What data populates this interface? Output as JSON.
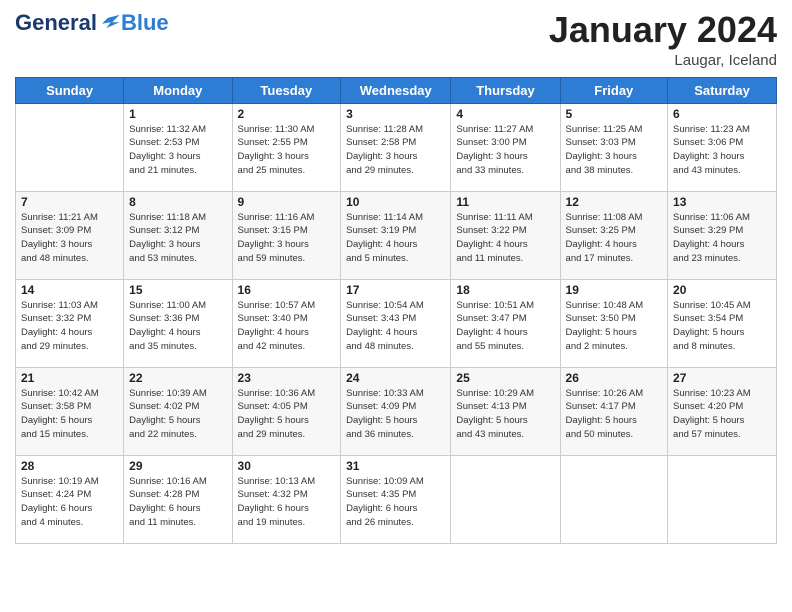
{
  "header": {
    "logo_general": "General",
    "logo_blue": "Blue",
    "month_title": "January 2024",
    "subtitle": "Laugar, Iceland"
  },
  "weekdays": [
    "Sunday",
    "Monday",
    "Tuesday",
    "Wednesday",
    "Thursday",
    "Friday",
    "Saturday"
  ],
  "weeks": [
    [
      {
        "num": "",
        "info": ""
      },
      {
        "num": "1",
        "info": "Sunrise: 11:32 AM\nSunset: 2:53 PM\nDaylight: 3 hours\nand 21 minutes."
      },
      {
        "num": "2",
        "info": "Sunrise: 11:30 AM\nSunset: 2:55 PM\nDaylight: 3 hours\nand 25 minutes."
      },
      {
        "num": "3",
        "info": "Sunrise: 11:28 AM\nSunset: 2:58 PM\nDaylight: 3 hours\nand 29 minutes."
      },
      {
        "num": "4",
        "info": "Sunrise: 11:27 AM\nSunset: 3:00 PM\nDaylight: 3 hours\nand 33 minutes."
      },
      {
        "num": "5",
        "info": "Sunrise: 11:25 AM\nSunset: 3:03 PM\nDaylight: 3 hours\nand 38 minutes."
      },
      {
        "num": "6",
        "info": "Sunrise: 11:23 AM\nSunset: 3:06 PM\nDaylight: 3 hours\nand 43 minutes."
      }
    ],
    [
      {
        "num": "7",
        "info": "Sunrise: 11:21 AM\nSunset: 3:09 PM\nDaylight: 3 hours\nand 48 minutes."
      },
      {
        "num": "8",
        "info": "Sunrise: 11:18 AM\nSunset: 3:12 PM\nDaylight: 3 hours\nand 53 minutes."
      },
      {
        "num": "9",
        "info": "Sunrise: 11:16 AM\nSunset: 3:15 PM\nDaylight: 3 hours\nand 59 minutes."
      },
      {
        "num": "10",
        "info": "Sunrise: 11:14 AM\nSunset: 3:19 PM\nDaylight: 4 hours\nand 5 minutes."
      },
      {
        "num": "11",
        "info": "Sunrise: 11:11 AM\nSunset: 3:22 PM\nDaylight: 4 hours\nand 11 minutes."
      },
      {
        "num": "12",
        "info": "Sunrise: 11:08 AM\nSunset: 3:25 PM\nDaylight: 4 hours\nand 17 minutes."
      },
      {
        "num": "13",
        "info": "Sunrise: 11:06 AM\nSunset: 3:29 PM\nDaylight: 4 hours\nand 23 minutes."
      }
    ],
    [
      {
        "num": "14",
        "info": "Sunrise: 11:03 AM\nSunset: 3:32 PM\nDaylight: 4 hours\nand 29 minutes."
      },
      {
        "num": "15",
        "info": "Sunrise: 11:00 AM\nSunset: 3:36 PM\nDaylight: 4 hours\nand 35 minutes."
      },
      {
        "num": "16",
        "info": "Sunrise: 10:57 AM\nSunset: 3:40 PM\nDaylight: 4 hours\nand 42 minutes."
      },
      {
        "num": "17",
        "info": "Sunrise: 10:54 AM\nSunset: 3:43 PM\nDaylight: 4 hours\nand 48 minutes."
      },
      {
        "num": "18",
        "info": "Sunrise: 10:51 AM\nSunset: 3:47 PM\nDaylight: 4 hours\nand 55 minutes."
      },
      {
        "num": "19",
        "info": "Sunrise: 10:48 AM\nSunset: 3:50 PM\nDaylight: 5 hours\nand 2 minutes."
      },
      {
        "num": "20",
        "info": "Sunrise: 10:45 AM\nSunset: 3:54 PM\nDaylight: 5 hours\nand 8 minutes."
      }
    ],
    [
      {
        "num": "21",
        "info": "Sunrise: 10:42 AM\nSunset: 3:58 PM\nDaylight: 5 hours\nand 15 minutes."
      },
      {
        "num": "22",
        "info": "Sunrise: 10:39 AM\nSunset: 4:02 PM\nDaylight: 5 hours\nand 22 minutes."
      },
      {
        "num": "23",
        "info": "Sunrise: 10:36 AM\nSunset: 4:05 PM\nDaylight: 5 hours\nand 29 minutes."
      },
      {
        "num": "24",
        "info": "Sunrise: 10:33 AM\nSunset: 4:09 PM\nDaylight: 5 hours\nand 36 minutes."
      },
      {
        "num": "25",
        "info": "Sunrise: 10:29 AM\nSunset: 4:13 PM\nDaylight: 5 hours\nand 43 minutes."
      },
      {
        "num": "26",
        "info": "Sunrise: 10:26 AM\nSunset: 4:17 PM\nDaylight: 5 hours\nand 50 minutes."
      },
      {
        "num": "27",
        "info": "Sunrise: 10:23 AM\nSunset: 4:20 PM\nDaylight: 5 hours\nand 57 minutes."
      }
    ],
    [
      {
        "num": "28",
        "info": "Sunrise: 10:19 AM\nSunset: 4:24 PM\nDaylight: 6 hours\nand 4 minutes."
      },
      {
        "num": "29",
        "info": "Sunrise: 10:16 AM\nSunset: 4:28 PM\nDaylight: 6 hours\nand 11 minutes."
      },
      {
        "num": "30",
        "info": "Sunrise: 10:13 AM\nSunset: 4:32 PM\nDaylight: 6 hours\nand 19 minutes."
      },
      {
        "num": "31",
        "info": "Sunrise: 10:09 AM\nSunset: 4:35 PM\nDaylight: 6 hours\nand 26 minutes."
      },
      {
        "num": "",
        "info": ""
      },
      {
        "num": "",
        "info": ""
      },
      {
        "num": "",
        "info": ""
      }
    ]
  ]
}
